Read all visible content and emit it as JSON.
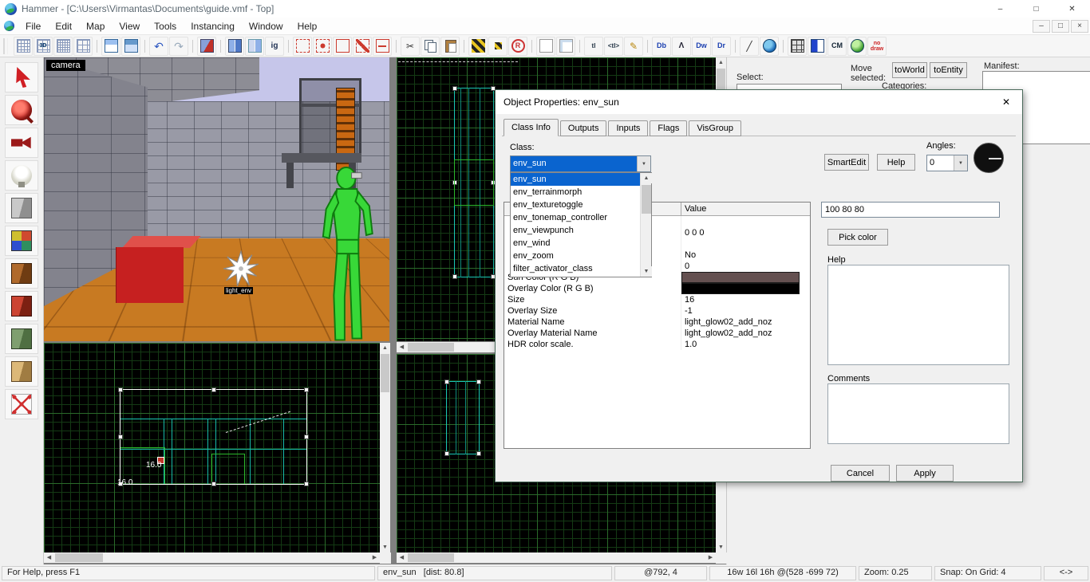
{
  "window": {
    "title": "Hammer - [C:\\Users\\Virmantas\\Documents\\guide.vmf - Top]",
    "controls": {
      "minimize": "–",
      "maximize": "□",
      "close": "✕"
    }
  },
  "icons": {
    "up": "▲",
    "down": "▼",
    "left": "◀",
    "right": "▶",
    "combo": "▼",
    "mdi_minimize": "–",
    "mdi_restore": "□",
    "mdi_close": "×"
  },
  "menu": {
    "items": [
      {
        "label": "File",
        "name": "menu-file"
      },
      {
        "label": "Edit",
        "name": "menu-edit"
      },
      {
        "label": "Map",
        "name": "menu-map"
      },
      {
        "label": "View",
        "name": "menu-view"
      },
      {
        "label": "Tools",
        "name": "menu-tools"
      },
      {
        "label": "Instancing",
        "name": "menu-instancing"
      },
      {
        "label": "Window",
        "name": "menu-window"
      },
      {
        "label": "Help",
        "name": "menu-help"
      }
    ]
  },
  "toolbar": {
    "buttons": [
      {
        "name": "toggle-grid-button",
        "cls": "i-grid",
        "g": ""
      },
      {
        "name": "toggle-3d-grid-button",
        "cls": "i-grid3d",
        "g": "3D"
      },
      {
        "name": "smaller-grid-button",
        "cls": "i-gridsmall",
        "g": ""
      },
      {
        "name": "larger-grid-button",
        "cls": "i-gridbig",
        "g": ""
      },
      {
        "name": "toolbar-separator",
        "cls": "tb-sep",
        "g": "",
        "ia": "false"
      },
      {
        "name": "load-window-state-button",
        "cls": "i-winload",
        "g": ""
      },
      {
        "name": "save-window-state-button",
        "cls": "i-winsave",
        "g": ""
      },
      {
        "name": "toolbar-separator",
        "cls": "tb-sep",
        "g": "",
        "ia": "false"
      },
      {
        "name": "undo-button",
        "cls": "i-undo",
        "g": "↶"
      },
      {
        "name": "redo-button",
        "cls": "i-redo",
        "g": "↷"
      },
      {
        "name": "toolbar-separator",
        "cls": "tb-sep",
        "g": "",
        "ia": "false"
      },
      {
        "name": "carve-button",
        "cls": "i-carve",
        "g": ""
      },
      {
        "name": "toolbar-separator",
        "cls": "tb-sep",
        "g": "",
        "ia": "false"
      },
      {
        "name": "group-button",
        "cls": "i-group",
        "g": ""
      },
      {
        "name": "ungroup-button",
        "cls": "i-ungroup",
        "g": ""
      },
      {
        "name": "ignore-groups-button",
        "cls": "i-ig",
        "g": "ig"
      },
      {
        "name": "toolbar-separator",
        "cls": "tb-sep",
        "g": "",
        "ia": "false"
      },
      {
        "name": "hide-selected-button",
        "cls": "i-dashcube",
        "g": ""
      },
      {
        "name": "hide-unselected-button",
        "cls": "i-dashcube2",
        "g": ""
      },
      {
        "name": "show-hidden-button",
        "cls": "i-dashcube3",
        "g": ""
      },
      {
        "name": "tie-to-entity-button",
        "cls": "i-dashcube4",
        "g": ""
      },
      {
        "name": "move-to-world-button",
        "cls": "i-dashcube5",
        "g": ""
      },
      {
        "name": "toolbar-separator",
        "cls": "tb-sep",
        "g": "",
        "ia": "false"
      },
      {
        "name": "cut-button",
        "cls": "i-cut",
        "g": "✂"
      },
      {
        "name": "copy-button",
        "cls": "i-copy",
        "g": ""
      },
      {
        "name": "paste-button",
        "cls": "i-paste",
        "g": ""
      },
      {
        "name": "toolbar-separator",
        "cls": "tb-sep",
        "g": "",
        "ia": "false"
      },
      {
        "name": "cordon-button",
        "cls": "i-cordon",
        "g": ""
      },
      {
        "name": "edit-cordon-button",
        "cls": "i-cordon2",
        "g": ""
      },
      {
        "name": "radius-culling-button",
        "cls": "i-rcircle",
        "g": "R"
      },
      {
        "name": "toolbar-separator",
        "cls": "tb-sep",
        "g": "",
        "ia": "false"
      },
      {
        "name": "select-groups-button",
        "cls": "i-white",
        "g": ""
      },
      {
        "name": "select-objects-button",
        "cls": "i-white2",
        "g": ""
      },
      {
        "name": "toolbar-separator",
        "cls": "tb-sep",
        "g": "",
        "ia": "false"
      },
      {
        "name": "texture-lock-button",
        "cls": "i-tl",
        "g": "tl"
      },
      {
        "name": "texture-scale-lock-button",
        "cls": "i-tl2",
        "g": "<tl>"
      },
      {
        "name": "edit-pencil-button",
        "cls": "i-pencil",
        "g": "✎"
      },
      {
        "name": "toolbar-separator",
        "cls": "tb-sep",
        "g": "",
        "ia": "false"
      },
      {
        "name": "show-detail-button",
        "cls": "i-db",
        "g": "Db"
      },
      {
        "name": "show-helpers-button",
        "cls": "i-dl",
        "g": "Λ"
      },
      {
        "name": "show-water-button",
        "cls": "i-dw",
        "g": "Dw"
      },
      {
        "name": "show-ruler-button",
        "cls": "i-dr",
        "g": "Dr"
      },
      {
        "name": "toolbar-separator",
        "cls": "tb-sep",
        "g": "",
        "ia": "false"
      },
      {
        "name": "angle-snap-button",
        "cls": "i-slope",
        "g": "╱"
      },
      {
        "name": "run-map-globe-button",
        "cls": "i-globe",
        "g": ""
      },
      {
        "name": "toolbar-separator",
        "cls": "tb-sep",
        "g": "",
        "ia": "false"
      },
      {
        "name": "texture-grid-button",
        "cls": "i-texgrid",
        "g": ""
      },
      {
        "name": "split-view-button",
        "cls": "i-split",
        "g": ""
      },
      {
        "name": "cm-button",
        "cls": "i-cm",
        "g": "CM"
      },
      {
        "name": "model-sphere-button",
        "cls": "i-sphere",
        "g": ""
      },
      {
        "name": "nodraw-button",
        "cls": "i-nodraw",
        "g": "no draw"
      }
    ]
  },
  "tools": {
    "buttons": [
      {
        "name": "selection-tool-button",
        "cls": "t-select"
      },
      {
        "name": "magnify-tool-button",
        "cls": "t-magnify"
      },
      {
        "name": "camera-tool-button",
        "cls": "t-camera"
      },
      {
        "name": "entity-tool-button",
        "cls": "t-entity"
      },
      {
        "name": "block-tool-button",
        "cls": "t-block"
      },
      {
        "name": "texture-application-button",
        "cls": "t-texapp"
      },
      {
        "name": "apply-current-texture-button",
        "cls": "t-applytex"
      },
      {
        "name": "decal-tool-button",
        "cls": "t-decal"
      },
      {
        "name": "overlay-tool-button",
        "cls": "t-overlay"
      },
      {
        "name": "clipping-tool-button",
        "cls": "t-clip"
      },
      {
        "name": "vertex-tool-button",
        "cls": "t-vertex"
      }
    ]
  },
  "viewport3d": {
    "camera_label": "camera",
    "sprite_label": "light_env"
  },
  "viewport2d": {
    "measure_a": "16.0",
    "measure_b": "16.0"
  },
  "right_panel": {
    "select_label": "Select:",
    "move_line1": "Move",
    "move_line2": "selected:",
    "to_world_label": "toWorld",
    "to_entity_label": "toEntity",
    "manifest_label": "Manifest:",
    "categories_label": "Categories:"
  },
  "dialog": {
    "title": "Object Properties: env_sun",
    "close": "✕",
    "tabs": [
      {
        "label": "Class Info",
        "name": "tab-class-info",
        "cls": "active"
      },
      {
        "label": "Outputs",
        "name": "tab-outputs",
        "cls": ""
      },
      {
        "label": "Inputs",
        "name": "tab-inputs",
        "cls": ""
      },
      {
        "label": "Flags",
        "name": "tab-flags",
        "cls": ""
      },
      {
        "label": "VisGroup",
        "name": "tab-visgroup",
        "cls": ""
      }
    ],
    "class_label": "Class:",
    "class_value": "env_sun",
    "smartedit_label": "SmartEdit",
    "help_button_label": "Help",
    "angles_label": "Angles:",
    "angles_value": "0",
    "dropdown_items": [
      {
        "label": "env_sun",
        "cls": "hl",
        "name": "dropdown-item-env_sun"
      },
      {
        "label": "env_terrainmorph",
        "cls": "",
        "name": "dropdown-item-env_terrainmorph"
      },
      {
        "label": "env_texturetoggle",
        "cls": "",
        "name": "dropdown-item-env_texturetoggle"
      },
      {
        "label": "env_tonemap_controller",
        "cls": "",
        "name": "dropdown-item-env_tonemap_controller"
      },
      {
        "label": "env_viewpunch",
        "cls": "",
        "name": "dropdown-item-env_viewpunch"
      },
      {
        "label": "env_wind",
        "cls": "",
        "name": "dropdown-item-env_wind"
      },
      {
        "label": "env_zoom",
        "cls": "",
        "name": "dropdown-item-env_zoom"
      },
      {
        "label": "filter_activator_class",
        "cls": "",
        "name": "dropdown-item-filter_activator_class"
      }
    ],
    "grid": {
      "key_header": "",
      "value_header": "Value",
      "rows": [
        {
          "key": "",
          "value": ""
        },
        {
          "key": "",
          "value": "0 0 0"
        },
        {
          "key": "",
          "value": ""
        },
        {
          "key": "",
          "value": "No"
        },
        {
          "key": "",
          "value": "0"
        },
        {
          "key": "Sun Color (R G B)",
          "value": "",
          "vstyle": "background:#645050;box-shadow:inset 0 0 0 1px #1a1a1a"
        },
        {
          "key": "Overlay Color (R G B)",
          "value": "",
          "vstyle": "background:#000000;box-shadow:inset 0 0 0 1px #1a1a1a"
        },
        {
          "key": "Size",
          "value": "16"
        },
        {
          "key": "Overlay Size",
          "value": "-1"
        },
        {
          "key": "Material Name",
          "value": "light_glow02_add_noz"
        },
        {
          "key": "Overlay Material Name",
          "value": "light_glow02_add_noz"
        },
        {
          "key": "HDR color scale.",
          "value": "1.0"
        }
      ]
    },
    "color_value": "100 80 80",
    "pick_color_label": "Pick color",
    "help_label": "Help",
    "comments_label": "Comments",
    "cancel_label": "Cancel",
    "apply_label": "Apply"
  },
  "status": {
    "segments": [
      {
        "name": "status-help",
        "text": "For Help, press F1",
        "cls": "s1",
        "ia": "false"
      },
      {
        "name": "status-selection",
        "text": "env_sun   [dist: 80.8]",
        "cls": "s2",
        "ia": "false"
      },
      {
        "name": "status-cursor-coordinates",
        "text": "@792, 4",
        "cls": "s3",
        "ia": "false"
      },
      {
        "name": "status-selection-size",
        "text": "16w 16l 16h @(528 -699 72)",
        "cls": "s4",
        "ia": "false"
      },
      {
        "name": "status-zoom",
        "text": "Zoom: 0.25",
        "cls": "s5",
        "ia": "false"
      },
      {
        "name": "status-snap",
        "text": "Snap: On Grid: 4",
        "cls": "s6",
        "ia": "false"
      },
      {
        "name": "status-resize-grip",
        "text": "<->",
        "cls": "s7",
        "ia": "true"
      }
    ]
  }
}
